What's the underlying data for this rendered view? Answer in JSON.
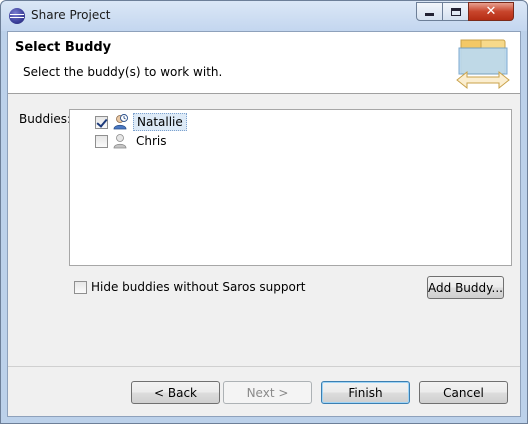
{
  "window": {
    "title": "Share Project"
  },
  "header": {
    "title": "Select Buddy",
    "description": "Select the buddy(s) to work with."
  },
  "buddies": {
    "label": "Buddies:",
    "items": [
      {
        "name": "Natallie",
        "checked": true,
        "icon": "buddy-online-icon"
      },
      {
        "name": "Chris",
        "checked": false,
        "icon": "buddy-offline-icon"
      }
    ]
  },
  "options": {
    "hide_label": "Hide buddies without Saros support",
    "hide_checked": false,
    "add_buddy_label": "Add Buddy..."
  },
  "footer": {
    "back_label": "< Back",
    "next_label": "Next >",
    "finish_label": "Finish",
    "cancel_label": "Cancel"
  }
}
